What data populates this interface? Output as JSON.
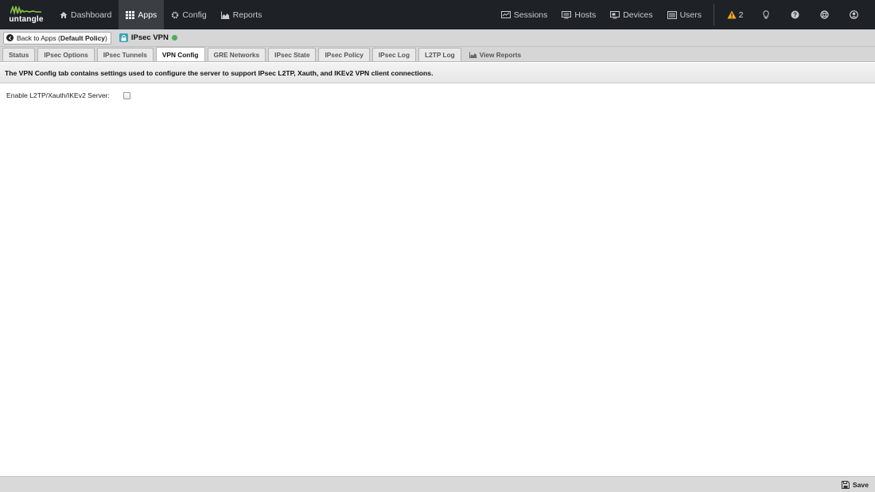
{
  "brand": {
    "name": "untangle",
    "accent": "#8bc34a"
  },
  "nav": {
    "items": [
      {
        "label": "Dashboard",
        "icon": "home-icon"
      },
      {
        "label": "Apps",
        "icon": "grid-icon",
        "active": true
      },
      {
        "label": "Config",
        "icon": "gear-icon"
      },
      {
        "label": "Reports",
        "icon": "area-chart-icon"
      }
    ],
    "right": [
      {
        "label": "Sessions",
        "icon": "sessions-icon"
      },
      {
        "label": "Hosts",
        "icon": "hosts-icon"
      },
      {
        "label": "Devices",
        "icon": "devices-icon"
      },
      {
        "label": "Users",
        "icon": "users-icon"
      }
    ],
    "alert_count": "2",
    "alert_color": "#f5a623"
  },
  "appbar": {
    "back_prefix": "Back to Apps (",
    "back_policy": "Default Policy",
    "back_suffix": ")",
    "app_name": "IPsec VPN",
    "status_color": "#4caf50"
  },
  "tabs": [
    {
      "label": "Status"
    },
    {
      "label": "IPsec Options"
    },
    {
      "label": "IPsec Tunnels"
    },
    {
      "label": "VPN Config",
      "active": true
    },
    {
      "label": "GRE Networks"
    },
    {
      "label": "IPsec State"
    },
    {
      "label": "IPsec Policy"
    },
    {
      "label": "IPsec Log"
    },
    {
      "label": "L2TP Log"
    }
  ],
  "view_reports_label": "View Reports",
  "description": "The VPN Config tab contains settings used to configure the server to support IPsec L2TP, Xauth, and IKEv2 VPN client connections.",
  "form": {
    "enable_label": "Enable L2TP/Xauth/IKEv2 Server:",
    "enable_checked": false
  },
  "footer": {
    "save_label": "Save"
  }
}
